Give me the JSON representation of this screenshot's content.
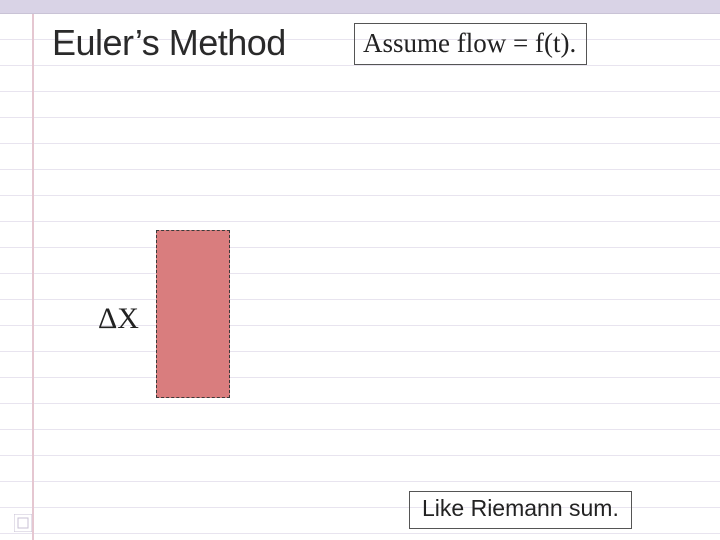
{
  "title": "Euler’s Method",
  "assume_box": "Assume flow = f(t).",
  "riemann_box": "Like Riemann sum.",
  "delta_label": "ΔX",
  "colors": {
    "top_bar": "#d9d3e6",
    "rule_line": "#e8e4ef",
    "margin_line": "#e5c7d1",
    "bar_fill": "#d97d7e"
  }
}
